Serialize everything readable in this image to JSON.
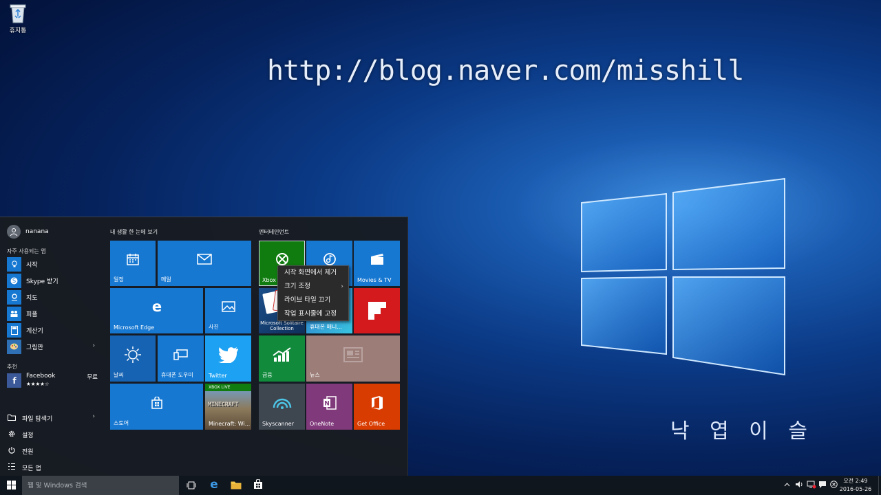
{
  "desktop": {
    "recycle_bin_label": "휴지통",
    "watermark_url": "http://blog.naver.com/misshill",
    "watermark_name": "낙 엽 이 슬"
  },
  "start_menu": {
    "user_name": "nanana",
    "most_used_header": "자주 사용되는 앱",
    "apps": [
      {
        "label": "시작",
        "icon": "lightbulb-icon"
      },
      {
        "label": "Skype 받기",
        "icon": "skype-icon"
      },
      {
        "label": "지도",
        "icon": "maps-icon"
      },
      {
        "label": "피플",
        "icon": "people-icon"
      },
      {
        "label": "계산기",
        "icon": "calculator-icon"
      },
      {
        "label": "그림판",
        "icon": "paint-icon",
        "arrow": "›"
      }
    ],
    "suggested_header": "추천",
    "suggested_app": {
      "name": "Facebook",
      "rating": "★★★★☆",
      "price": "무료"
    },
    "bottom": [
      {
        "label": "파일 탐색기",
        "icon": "file-explorer-icon",
        "arrow": "›"
      },
      {
        "label": "설정",
        "icon": "settings-gear-icon"
      },
      {
        "label": "전원",
        "icon": "power-icon"
      },
      {
        "label": "모든 앱",
        "icon": "all-apps-icon"
      }
    ],
    "group1_header": "내 생활 한 눈에 보기",
    "group2_header": "엔터테인먼트",
    "tiles": {
      "calendar": "일정",
      "mail": "메일",
      "edge": "Microsoft Edge",
      "photos": "사진",
      "weather": "날씨",
      "phone": "휴대폰 도우미",
      "twitter": "Twitter",
      "store": "스토어",
      "minecraft": "Minecraft: Wi...",
      "xbox_live_badge": "XBOX LIVE",
      "minecraft_logo": "MINECRAFT",
      "xbox": "Xbox",
      "groove": "",
      "movies": "Movies & TV",
      "solitaire": "Microsoft Solitaire Collection",
      "phone_manager": "휴대폰 매니...",
      "flipboard": "",
      "money": "금융",
      "news": "뉴스",
      "skyscanner": "Skyscanner",
      "onenote": "OneNote",
      "office": "Get Office"
    },
    "context_menu": [
      {
        "label": "시작 화면에서 제거",
        "sub": ""
      },
      {
        "label": "크기 조정",
        "sub": "›"
      },
      {
        "label": "라이브 타일 끄기",
        "sub": ""
      },
      {
        "label": "작업 표시줄에 고정",
        "sub": ""
      }
    ]
  },
  "taskbar": {
    "search_placeholder": "웹 및 Windows 검색",
    "clock_time": "오전 2:49",
    "clock_date": "2016-05-26"
  },
  "colors": {
    "tile_blue": "#1778d2",
    "tile_green": "#118a3c",
    "xbox_green": "#107c10",
    "flipboard_red": "#d41a1c",
    "office_orange": "#d93c00",
    "onenote_purple": "#80397b",
    "skyscanner_gray": "#3e4650",
    "news_mauve": "#9c7d78"
  }
}
